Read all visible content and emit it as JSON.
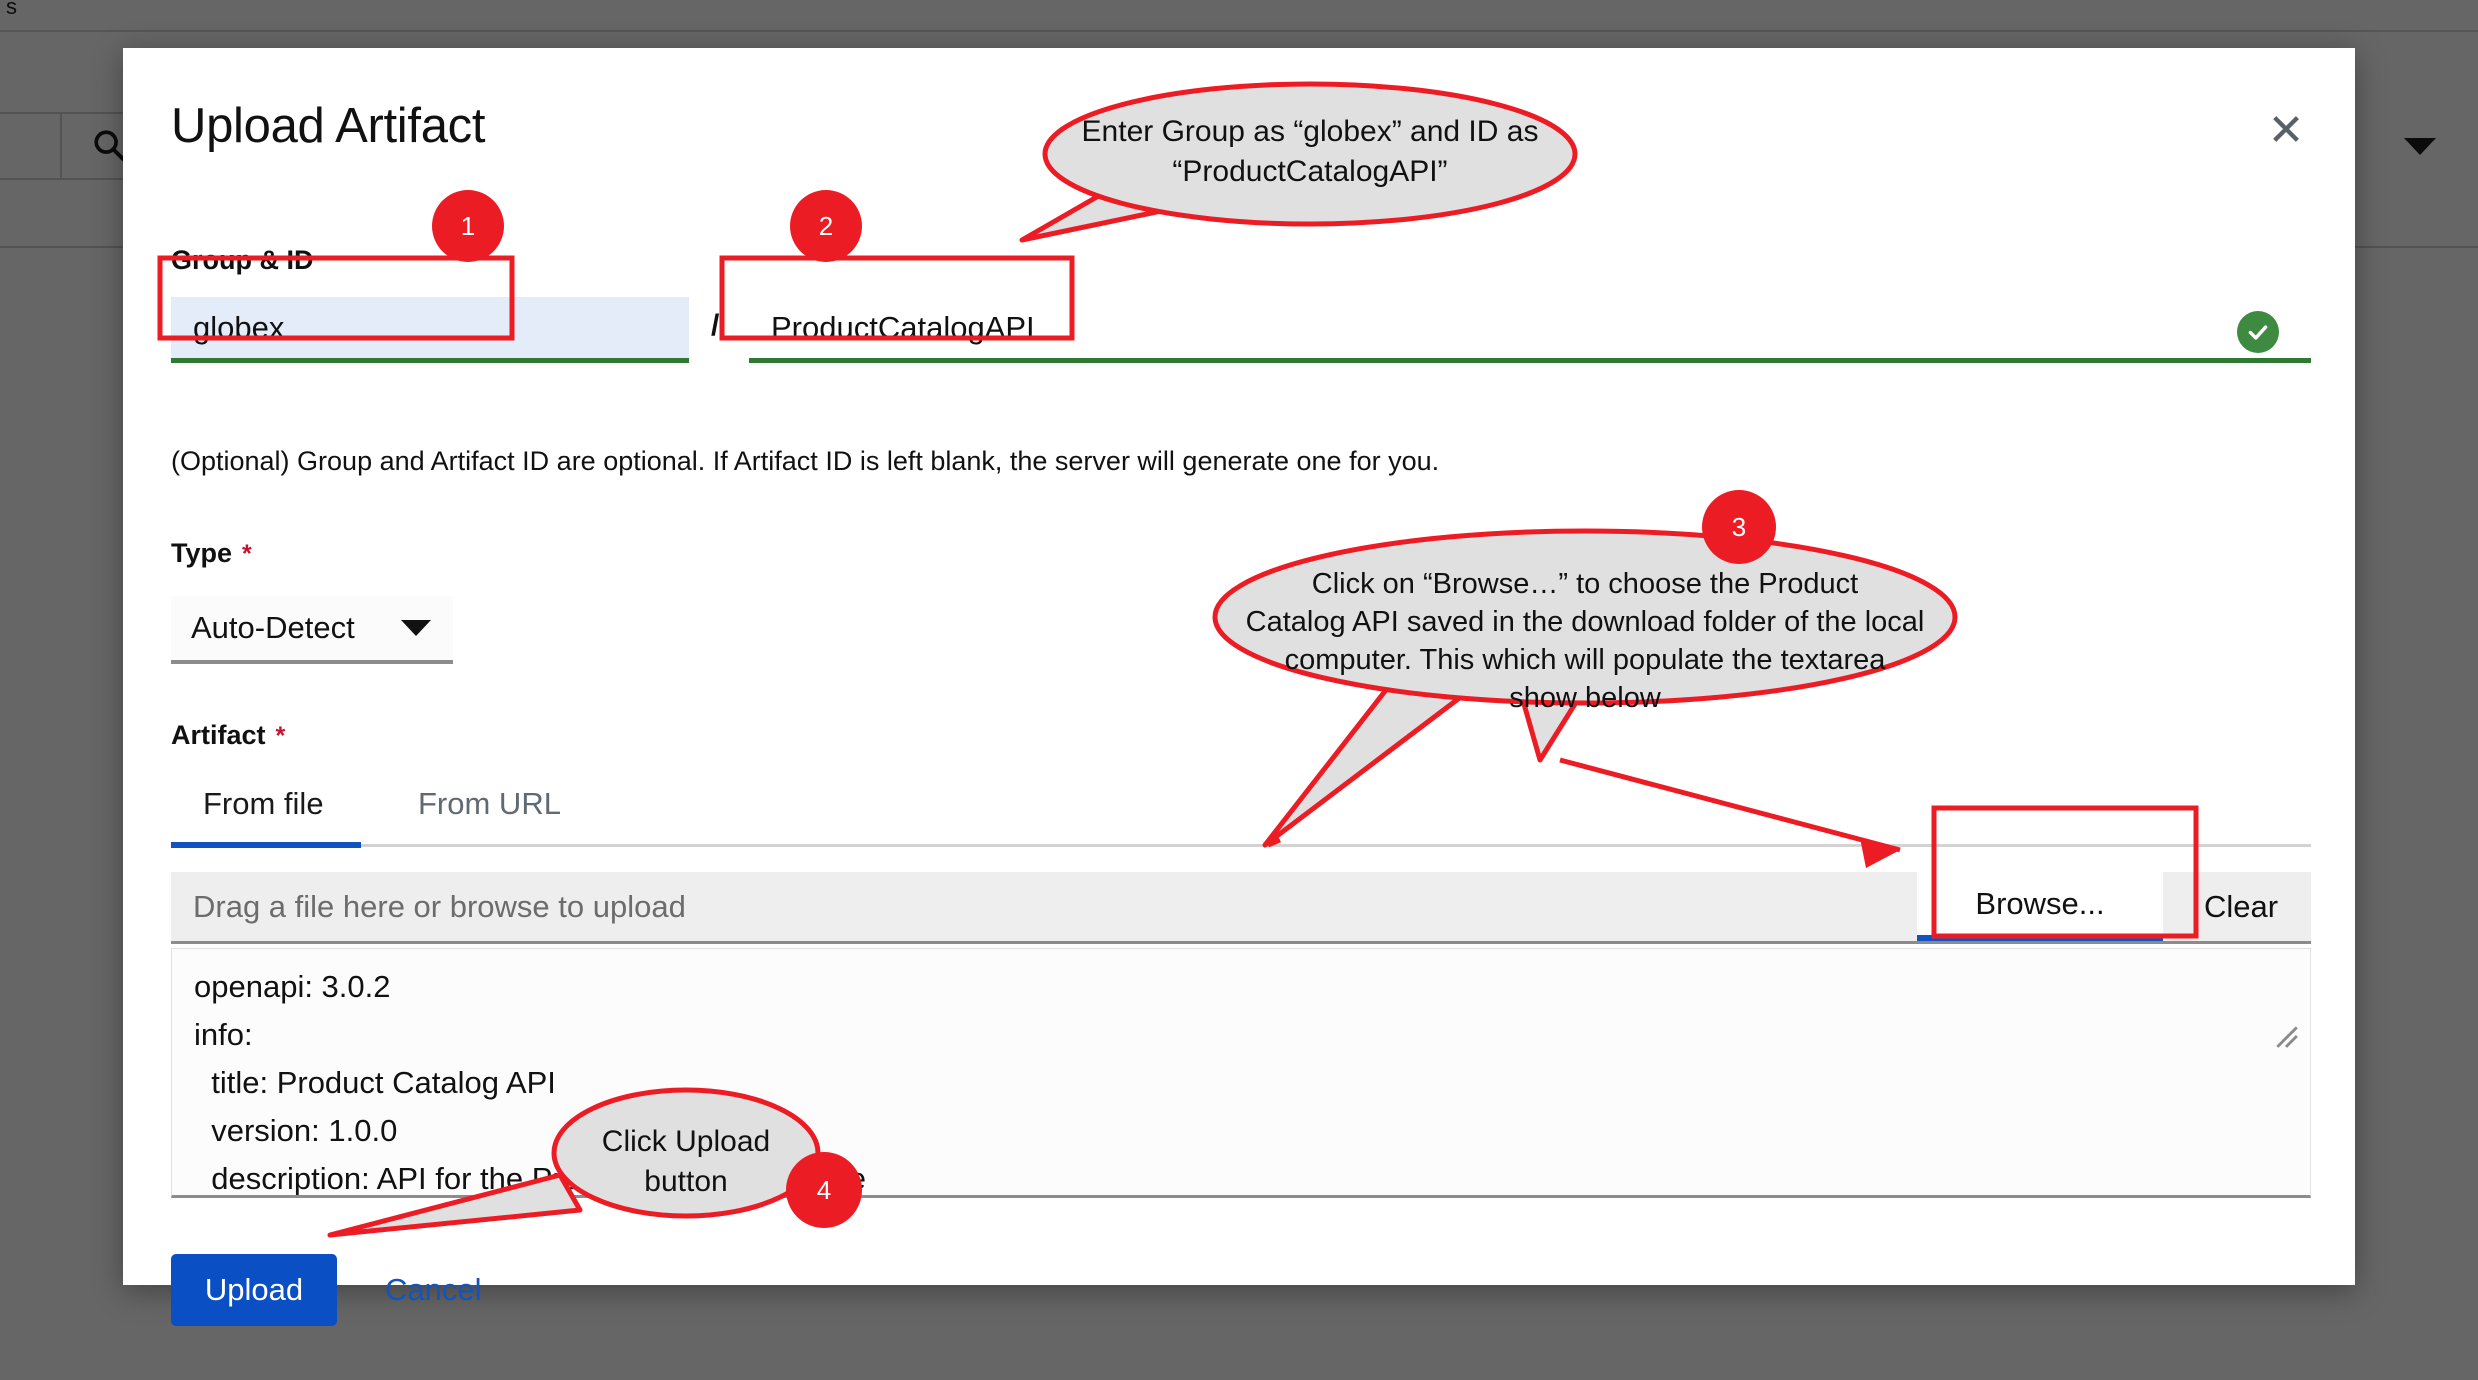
{
  "background": {
    "top_label": "s",
    "search_icon": "search-icon",
    "caret_icon": "chevron-down-icon"
  },
  "modal": {
    "title": "Upload Artifact",
    "close_icon": "✕",
    "group_id": {
      "label": "Group & ID",
      "group_value": "globex",
      "separator": "/",
      "id_value": "ProductCatalogAPI",
      "valid_icon": "check-circle-icon",
      "note": "(Optional) Group and Artifact ID are optional. If Artifact ID is left blank, the server will generate one for you."
    },
    "type": {
      "label": "Type",
      "required_mark": "*",
      "selected": "Auto-Detect",
      "caret_icon": "chevron-down-icon"
    },
    "artifact": {
      "label": "Artifact",
      "required_mark": "*",
      "tabs": [
        {
          "label": "From file",
          "active": true
        },
        {
          "label": "From URL",
          "active": false
        }
      ],
      "dropzone_placeholder": "Drag a file here or browse to upload",
      "browse_label": "Browse...",
      "clear_label": "Clear",
      "yaml_content": "openapi: 3.0.2\ninfo:\n  title: Product Catalog API\n  version: 1.0.0\n  description: API for the Product Catalog Service"
    },
    "footer": {
      "upload_label": "Upload",
      "cancel_label": "Cancel"
    }
  },
  "annotations": {
    "badges": [
      {
        "number": "1"
      },
      {
        "number": "2"
      },
      {
        "number": "3"
      },
      {
        "number": "4"
      }
    ],
    "callouts": [
      {
        "id": "callout-1",
        "line1": "Enter Group as “globex”  and ID as",
        "line2": "“ProductCatalogAPI”"
      },
      {
        "id": "callout-3",
        "line1": "Click on “Browse…” to choose the Product",
        "line2": "Catalog API saved in the download folder of the local",
        "line3": "computer. This which will populate the textarea",
        "line4": "show below"
      },
      {
        "id": "callout-4",
        "line1": "Click Upload",
        "line2": "button"
      }
    ],
    "colors": {
      "annotation_red": "#ec1c24",
      "bubble_fill": "#e0e0e0",
      "valid_green": "#3e8a41",
      "primary_blue": "#0a4fc4"
    }
  }
}
